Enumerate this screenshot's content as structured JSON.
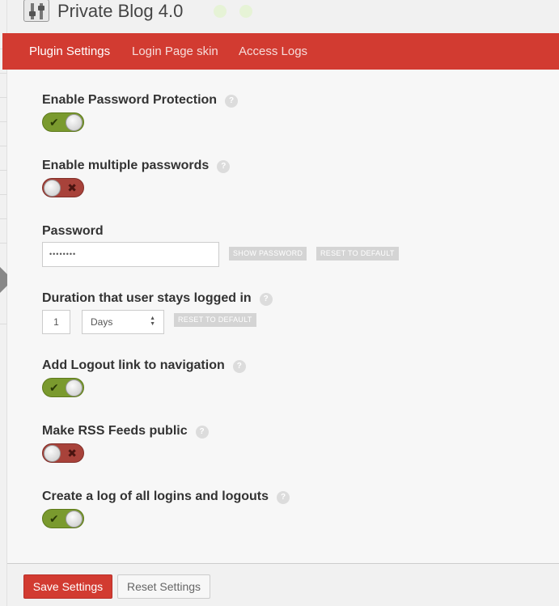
{
  "app": {
    "title": "Private Blog 4.0"
  },
  "nav": {
    "tabs": [
      "Plugin Settings",
      "Login Page skin",
      "Access Logs"
    ]
  },
  "help_glyph": "?",
  "settings": {
    "password_protection": {
      "label": "Enable Password Protection",
      "enabled": true
    },
    "multiple_passwords": {
      "label": "Enable multiple passwords",
      "enabled": false
    },
    "password": {
      "label": "Password",
      "value": "••••••••",
      "show_button": "SHOW PASSWORD",
      "reset_button": "RESET TO DEFAULT"
    },
    "duration": {
      "label": "Duration that user stays logged in",
      "value": "1",
      "unit": "Days",
      "reset_button": "RESET TO DEFAULT"
    },
    "logout_link": {
      "label": "Add Logout link to navigation",
      "enabled": true
    },
    "rss_public": {
      "label": "Make RSS Feeds public",
      "enabled": false
    },
    "login_log": {
      "label": "Create a log of all logins and logouts",
      "enabled": true
    }
  },
  "toggle_marks": {
    "on": "✔",
    "off": "✖"
  },
  "footer": {
    "save_label": "Save Settings",
    "reset_label": "Reset Settings"
  },
  "colors": {
    "accent": "#d23b31",
    "toggle_on": "#7a9a2e",
    "toggle_off": "#a8423a"
  }
}
